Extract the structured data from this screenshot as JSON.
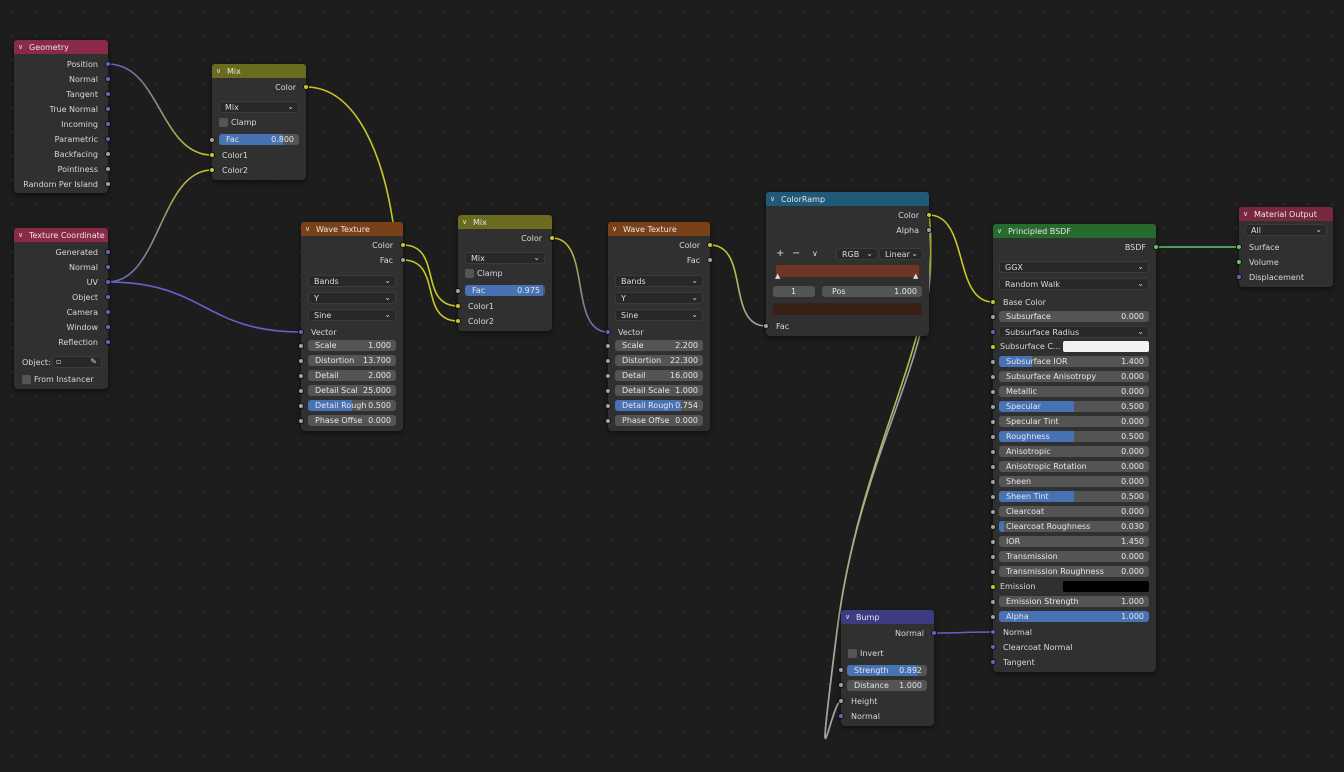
{
  "colors": {
    "geometry_header": "#8b2a46",
    "texcoord_header": "#8b2a46",
    "mix_header": "#6b6b1f",
    "wave_header": "#7a4119",
    "ramp_header": "#1f5a78",
    "bsdf_header": "#266b2c",
    "output_header": "#7a2740",
    "bump_header": "#3c3c83",
    "socket_vector": "#6363c7",
    "socket_color": "#c7c729",
    "socket_float": "#a1a1a1",
    "socket_shader": "#63c763",
    "wire_vector": "#6363c7",
    "wire_color": "#c7c729",
    "wire_float": "#a1a1a1",
    "wire_shader": "#63c763"
  },
  "geometry": {
    "title": "Geometry",
    "outputs": [
      "Position",
      "Normal",
      "Tangent",
      "True Normal",
      "Incoming",
      "Parametric",
      "Backfacing",
      "Pointiness",
      "Random Per Island"
    ]
  },
  "texcoord": {
    "title": "Texture Coordinate",
    "outputs": [
      "Generated",
      "Normal",
      "UV",
      "Object",
      "Camera",
      "Window",
      "Reflection"
    ],
    "object_label": "Object:",
    "from_instancer": "From Instancer"
  },
  "mix1": {
    "title": "Mix",
    "out": "Color",
    "blend": "Mix",
    "clamp": "Clamp",
    "fac_label": "Fac",
    "fac_value": "0.800",
    "fac_fraction": 0.8,
    "in1": "Color1",
    "in2": "Color2"
  },
  "wave1": {
    "title": "Wave Texture",
    "out_color": "Color",
    "out_fac": "Fac",
    "type": "Bands",
    "axis": "Y",
    "profile": "Sine",
    "in_vector": "Vector",
    "fields": [
      {
        "name": "Scale",
        "value": "1.000",
        "fill": 0
      },
      {
        "name": "Distortion",
        "value": "13.700",
        "fill": 0
      },
      {
        "name": "Detail",
        "value": "2.000",
        "fill": 0
      },
      {
        "name": "Detail Scal",
        "value": "25.000",
        "fill": 0
      },
      {
        "name": "Detail Rough",
        "value": "0.500",
        "fill": 0.5
      },
      {
        "name": "Phase Offse",
        "value": "0.000",
        "fill": 0
      }
    ]
  },
  "mix2": {
    "title": "Mix",
    "out": "Color",
    "blend": "Mix",
    "clamp": "Clamp",
    "fac_label": "Fac",
    "fac_value": "0.975",
    "fac_fraction": 0.975,
    "in1": "Color1",
    "in2": "Color2"
  },
  "wave2": {
    "title": "Wave Texture",
    "out_color": "Color",
    "out_fac": "Fac",
    "type": "Bands",
    "axis": "Y",
    "profile": "Sine",
    "in_vector": "Vector",
    "fields": [
      {
        "name": "Scale",
        "value": "2.200",
        "fill": 0
      },
      {
        "name": "Distortion",
        "value": "22.300",
        "fill": 0
      },
      {
        "name": "Detail",
        "value": "16.000",
        "fill": 0
      },
      {
        "name": "Detail Scale",
        "value": "1.000",
        "fill": 0
      },
      {
        "name": "Detail Rough",
        "value": "0.754",
        "fill": 0.754
      },
      {
        "name": "Phase Offse",
        "value": "0.000",
        "fill": 0
      }
    ]
  },
  "ramp": {
    "title": "ColorRamp",
    "out_color": "Color",
    "out_alpha": "Alpha",
    "plus": "+",
    "minus": "−",
    "menu": "∨",
    "mode": "RGB",
    "interp": "Linear",
    "stop_index": "1",
    "pos_label": "Pos",
    "pos_value": "1.000",
    "ramp_color": "#6e3524",
    "stop_color": "#3a2116",
    "in_fac": "Fac"
  },
  "bsdf": {
    "title": "Principled BSDF",
    "out": "BSDF",
    "distribution": "GGX",
    "subsurface_method": "Random Walk",
    "base_color": "Base Color",
    "fields": [
      {
        "name": "Subsurface",
        "value": "0.000",
        "fill": 0,
        "socket": "float"
      },
      {
        "name": "Subsurface Radius",
        "value": "",
        "fill": 0,
        "socket": "vector",
        "dropdown": true
      },
      {
        "name": "Subsurface C...",
        "value": "",
        "fill": 0,
        "socket": "color",
        "swatch": "#f2f2f2",
        "plain": true
      },
      {
        "name": "Subsurface IOR",
        "value": "1.400",
        "fill": 0.22,
        "socket": "float"
      },
      {
        "name": "Subsurface Anisotropy",
        "value": "0.000",
        "fill": 0,
        "socket": "float"
      },
      {
        "name": "Metallic",
        "value": "0.000",
        "fill": 0,
        "socket": "float"
      },
      {
        "name": "Specular",
        "value": "0.500",
        "fill": 0.5,
        "socket": "float"
      },
      {
        "name": "Specular Tint",
        "value": "0.000",
        "fill": 0,
        "socket": "float"
      },
      {
        "name": "Roughness",
        "value": "0.500",
        "fill": 0.5,
        "socket": "float"
      },
      {
        "name": "Anisotropic",
        "value": "0.000",
        "fill": 0,
        "socket": "float"
      },
      {
        "name": "Anisotropic Rotation",
        "value": "0.000",
        "fill": 0,
        "socket": "float"
      },
      {
        "name": "Sheen",
        "value": "0.000",
        "fill": 0,
        "socket": "float"
      },
      {
        "name": "Sheen Tint",
        "value": "0.500",
        "fill": 0.5,
        "socket": "float"
      },
      {
        "name": "Clearcoat",
        "value": "0.000",
        "fill": 0,
        "socket": "float"
      },
      {
        "name": "Clearcoat Roughness",
        "value": "0.030",
        "fill": 0.03,
        "socket": "float"
      },
      {
        "name": "IOR",
        "value": "1.450",
        "fill": 0,
        "socket": "float"
      },
      {
        "name": "Transmission",
        "value": "0.000",
        "fill": 0,
        "socket": "float"
      },
      {
        "name": "Transmission Roughness",
        "value": "0.000",
        "fill": 0,
        "socket": "float"
      },
      {
        "name": "Emission",
        "value": "",
        "fill": 0,
        "socket": "color",
        "swatch": "#000000",
        "plain": true
      },
      {
        "name": "Emission Strength",
        "value": "1.000",
        "fill": 0,
        "socket": "float"
      },
      {
        "name": "Alpha",
        "value": "1.000",
        "fill": 1,
        "socket": "float"
      }
    ],
    "in_normal": "Normal",
    "in_clearcoat_normal": "Clearcoat Normal",
    "in_tangent": "Tangent"
  },
  "output": {
    "title": "Material Output",
    "target": "All",
    "inputs": [
      "Surface",
      "Volume",
      "Displacement"
    ]
  },
  "bump": {
    "title": "Bump",
    "out": "Normal",
    "invert": "Invert",
    "strength_label": "Strength",
    "strength_value": "0.892",
    "strength_fraction": 0.892,
    "distance_label": "Distance",
    "distance_value": "1.000",
    "in_height": "Height",
    "in_normal": "Normal"
  }
}
